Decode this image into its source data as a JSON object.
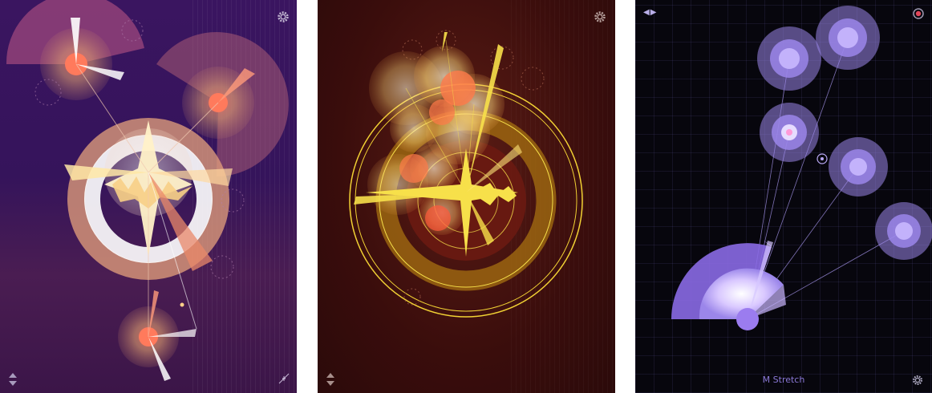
{
  "panels": [
    {
      "id": "amber",
      "controls": [
        "settings-icon",
        "updown-arrows-icon",
        "waveform-icon"
      ]
    },
    {
      "id": "fire",
      "controls": [
        "settings-icon",
        "updown-arrows-icon"
      ]
    },
    {
      "id": "violet",
      "mode_label": "M Stretch",
      "controls": [
        "nav-arrows-icon",
        "record-icon",
        "settings-icon"
      ]
    }
  ],
  "violet": {
    "nav_arrows": "◀▶"
  },
  "colors": {
    "amber_bg": "#35145b",
    "fire_bg": "#3a0d0c",
    "violet_bg": "#07060d",
    "accent_violet": "#9b86ea",
    "accent_yellow": "#f7e04a"
  }
}
